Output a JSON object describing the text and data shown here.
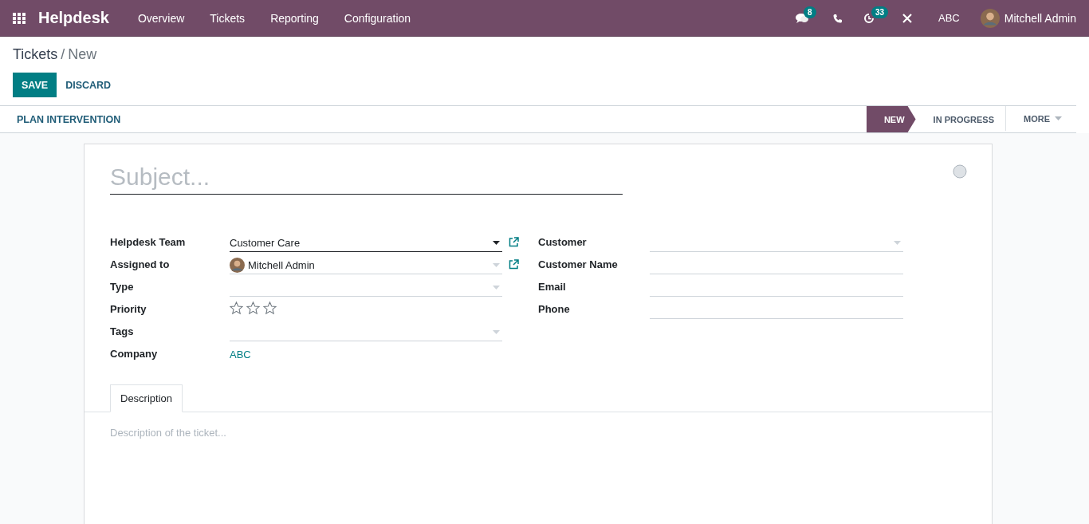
{
  "navbar": {
    "app_name": "Helpdesk",
    "menu": [
      "Overview",
      "Tickets",
      "Reporting",
      "Configuration"
    ],
    "messages_badge": "8",
    "activities_badge": "33",
    "company": "ABC",
    "user": "Mitchell Admin"
  },
  "breadcrumb": {
    "parent": "Tickets",
    "separator": "/",
    "current": "New"
  },
  "buttons": {
    "save": "SAVE",
    "discard": "DISCARD"
  },
  "statusbar": {
    "actions": [
      "PLAN INTERVENTION"
    ],
    "stages": [
      {
        "label": "NEW",
        "selected": true
      },
      {
        "label": "IN PROGRESS",
        "selected": false
      }
    ],
    "more": "MORE"
  },
  "form": {
    "subject_placeholder": "Subject...",
    "left_fields": [
      {
        "label": "Helpdesk Team",
        "kind": "many2one",
        "value": "Customer Care",
        "focused": true,
        "external_link": true
      },
      {
        "label": "Assigned to",
        "kind": "avatar",
        "value": "Mitchell Admin",
        "focused": false,
        "external_link": true
      },
      {
        "label": "Type",
        "kind": "many2one",
        "focused": false,
        "external_link": false
      },
      {
        "label": "Priority",
        "kind": "stars",
        "stars": 0
      },
      {
        "label": "Tags",
        "kind": "many2one",
        "focused": false,
        "external_link": false
      },
      {
        "label": "Company",
        "kind": "link",
        "value": "ABC"
      }
    ],
    "right_fields": [
      {
        "label": "Customer",
        "kind": "many2one",
        "focused": false
      },
      {
        "label": "Customer Name",
        "kind": "text",
        "focused": false
      },
      {
        "label": "Email",
        "kind": "text",
        "focused": false
      },
      {
        "label": "Phone",
        "kind": "text",
        "focused": false
      }
    ],
    "tabs": [
      {
        "label": "Description",
        "selected": true
      }
    ],
    "description_placeholder": "Description of the ticket..."
  }
}
